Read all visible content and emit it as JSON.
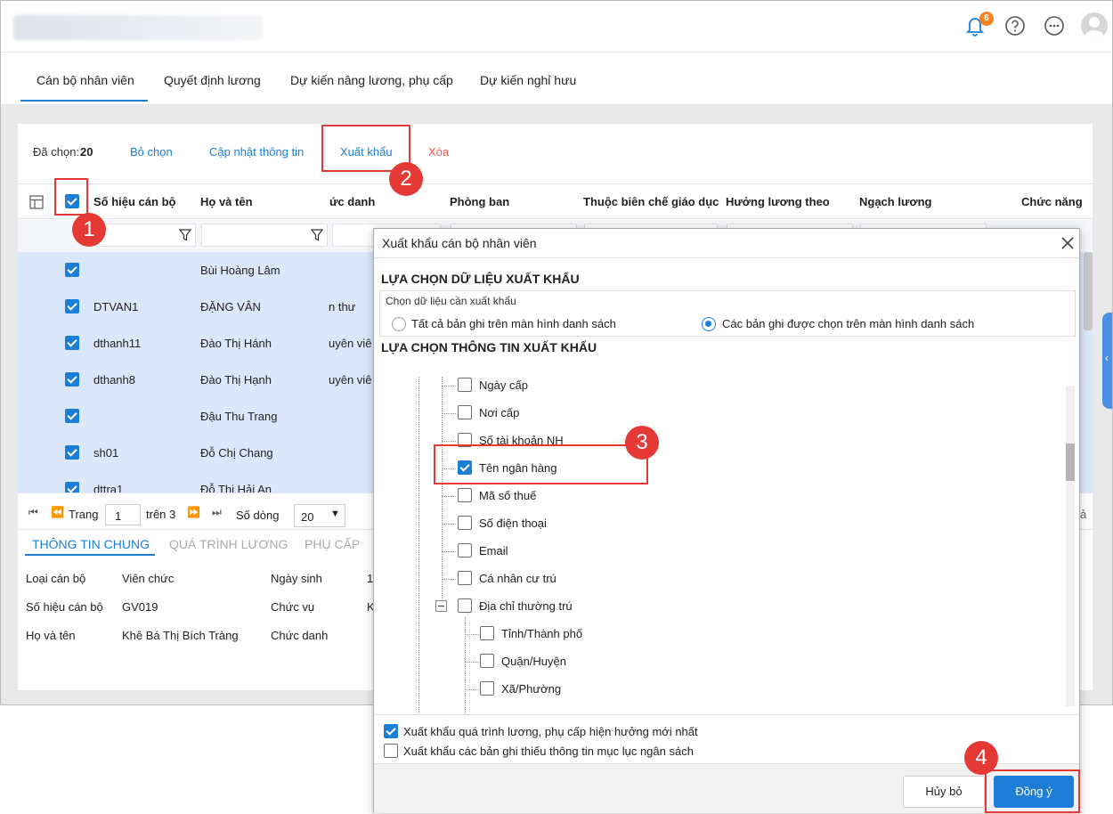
{
  "header": {
    "notification_count": "6"
  },
  "tabs": [
    {
      "label": "Cán bộ nhân viên"
    },
    {
      "label": "Quyết định lương"
    },
    {
      "label": "Dự kiến nâng lương, phụ cấp"
    },
    {
      "label": "Dự kiến nghỉ hưu"
    }
  ],
  "toolbar": {
    "selected_label": "Đã chọn:",
    "selected_count": "20",
    "deselect": "Bỏ chọn",
    "update_info": "Cập nhật thông tin",
    "export": "Xuất khẩu",
    "delete": "Xóa"
  },
  "table": {
    "columns": [
      "Số hiệu cán bộ",
      "Họ và tên",
      "ức danh",
      "Phòng ban",
      "Thuộc biên chế giáo dục",
      "Hưởng lương theo",
      "Ngạch lương",
      "Chức năng"
    ],
    "rows": [
      {
        "code": "",
        "name": "Bùi Hoàng Lâm",
        "title": ""
      },
      {
        "code": "DTVAN1",
        "name": "ĐẶNG VÂN",
        "title": "n thư"
      },
      {
        "code": "dthanh11",
        "name": "Đào Thị Hánh",
        "title": "uyên viê"
      },
      {
        "code": "dthanh8",
        "name": "Đào Thị Hạnh",
        "title": "uyên viê"
      },
      {
        "code": "",
        "name": "Đậu Thu Trang",
        "title": ""
      },
      {
        "code": "sh01",
        "name": "Đỗ Chị Chang",
        "title": ""
      },
      {
        "code": "dttra1",
        "name": "Đỗ Thị Hải An",
        "title": ""
      }
    ]
  },
  "pager": {
    "page_label": "Trang",
    "page_value": "1",
    "of_label": "trên 3",
    "rows_label": "Số dòng",
    "rows_value": "20",
    "trailing": "ả"
  },
  "detail": {
    "tabs": [
      "THÔNG TIN CHUNG",
      "QUÁ TRÌNH LƯƠNG",
      "PHỤ CẤP"
    ],
    "fields": [
      {
        "label": "Loại cán bộ",
        "value": "Viên chức",
        "label2": "Ngày sinh",
        "value2": "1"
      },
      {
        "label": "Số hiệu cán bộ",
        "value": "GV019",
        "label2": "Chức vụ",
        "value2": "K"
      },
      {
        "label": "Họ và tên",
        "value": "Khê Bá Thị Bích Tràng",
        "label2": "Chức danh",
        "value2": ""
      }
    ]
  },
  "dialog": {
    "title": "Xuất khẩu cán bộ nhân viên",
    "section1": "LỰA CHỌN DỮ LIỆU XUẤT KHẨU",
    "choose_label": "Chọn dữ liệu cần xuất khẩu",
    "radio_all": "Tất cả bản ghi trên màn hình danh sách",
    "radio_selected": "Các bản ghi được chọn trên màn hình danh sách",
    "section2": "LỰA CHỌN THÔNG TIN XUẤT KHẨU",
    "tree": [
      {
        "label": "Ngày cấp",
        "checked": false
      },
      {
        "label": "Nơi cấp",
        "checked": false
      },
      {
        "label": "Số tài khoản NH",
        "checked": false
      },
      {
        "label": "Tên ngân hàng",
        "checked": true
      },
      {
        "label": "Mã số thuế",
        "checked": false
      },
      {
        "label": "Số điện thoại",
        "checked": false
      },
      {
        "label": "Email",
        "checked": false
      },
      {
        "label": "Cá nhân cư trú",
        "checked": false
      },
      {
        "label": "Địa chỉ thường trú",
        "checked": false
      },
      {
        "label": "Tỉnh/Thành phố",
        "checked": false
      },
      {
        "label": "Quận/Huyện",
        "checked": false
      },
      {
        "label": "Xã/Phường",
        "checked": false
      }
    ],
    "opt_latest": "Xuất khẩu quá trình lương, phụ cấp hiện hưởng mới nhất",
    "opt_missing": "Xuất khẩu các bản ghi thiếu thông tin mục lục ngân sách",
    "cancel": "Hủy bỏ",
    "ok": "Đồng ý"
  },
  "steps": [
    "1",
    "2",
    "3",
    "4"
  ],
  "colors": {
    "accent": "#1d7ed8",
    "highlight": "#e53935",
    "selected_row": "#dbe8fb",
    "delete": "#e85a5a"
  }
}
